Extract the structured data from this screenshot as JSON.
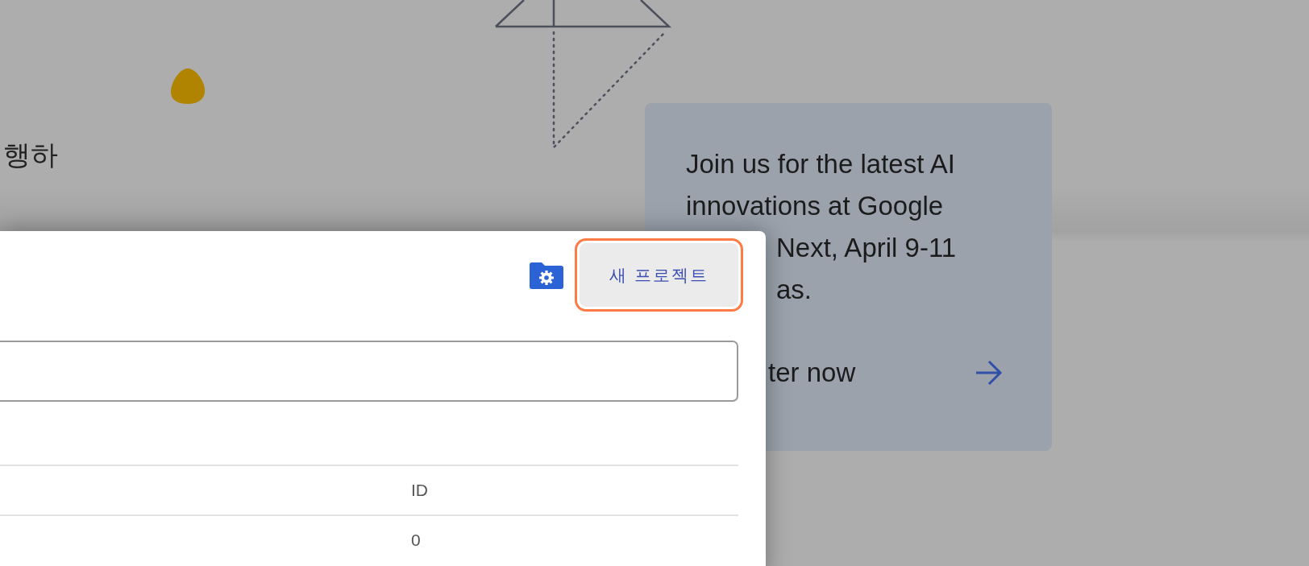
{
  "background": {
    "text": "행하"
  },
  "promo": {
    "lines": [
      {
        "text": "Join us for the latest AI",
        "covered": false
      },
      {
        "text": "innovations at Google",
        "covered": false
      },
      {
        "text": "Next, April 9-11",
        "covered": true
      },
      {
        "text": "as.",
        "covered": true
      }
    ],
    "link": "ter now"
  },
  "dialog": {
    "new_project_button": {
      "label": "새 프로젝트",
      "highlighted": true
    },
    "table": {
      "columns": [
        "ID"
      ],
      "rows": [
        [
          "0"
        ]
      ]
    }
  }
}
